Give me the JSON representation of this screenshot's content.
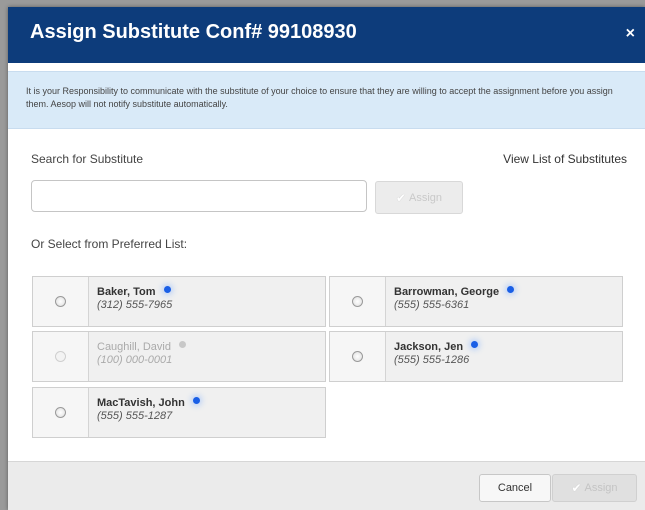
{
  "dialog": {
    "title": "Assign Substitute Conf# 99108930",
    "close_glyph": "×",
    "notice": "It is your Responsibility to communicate with the substitute of your choice to ensure that they are willing to accept the assignment before you assign them. Aesop will not notify substitute automatically."
  },
  "search": {
    "label": "Search for Substitute",
    "view_list_link": "View List of Substitutes",
    "input_value": "",
    "input_placeholder": "",
    "assign_label": "Assign",
    "assign_icon": "checkmark-icon"
  },
  "preferred": {
    "label": "Or Select from Preferred List:",
    "substitutes": [
      {
        "name": "Baker, Tom",
        "phone": "(312) 555-7965",
        "available": true
      },
      {
        "name": "Barrowman, George",
        "phone": "(555) 555-6361",
        "available": true
      },
      {
        "name": "Caughill, David",
        "phone": "(100) 000-0001",
        "available": false
      },
      {
        "name": "Jackson, Jen",
        "phone": "(555) 555-1286",
        "available": true
      },
      {
        "name": "MacTavish, John",
        "phone": "(555) 555-1287",
        "available": true
      }
    ]
  },
  "footer": {
    "cancel_label": "Cancel",
    "assign_label": "Assign"
  },
  "colors": {
    "header_bg": "#0d3c7b",
    "notice_bg": "#d9eaf8",
    "status_dot_available": "#1a5fe6",
    "status_dot_unavailable": "#c8c8c8"
  }
}
